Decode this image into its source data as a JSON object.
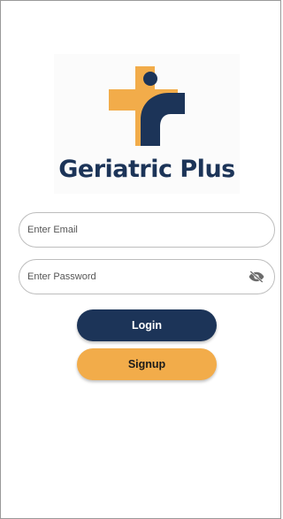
{
  "brand": {
    "name": "Geriatric Plus",
    "logo_icon": "medical-cross-person-logo",
    "colors": {
      "navy": "#1c3458",
      "gold": "#f2ac4a"
    }
  },
  "form": {
    "email": {
      "placeholder": "Enter Email",
      "value": ""
    },
    "password": {
      "placeholder": "Enter Password",
      "value": "",
      "toggle_icon": "eye-off-icon"
    }
  },
  "actions": {
    "login_label": "Login",
    "signup_label": "Signup"
  }
}
